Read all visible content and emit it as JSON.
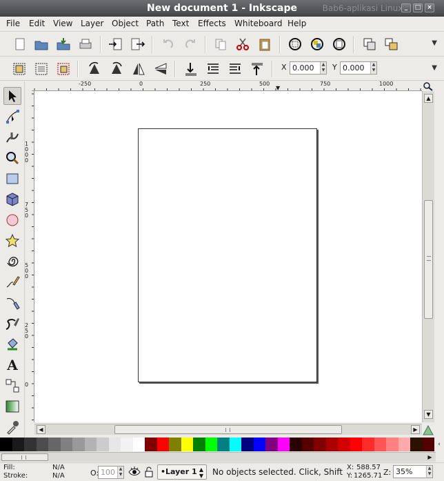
{
  "window": {
    "title": "New document 1 - Inkscape",
    "watermark": "Bab6-aplikasi Linux"
  },
  "menu": {
    "items": [
      "File",
      "Edit",
      "View",
      "Layer",
      "Object",
      "Path",
      "Text",
      "Effects",
      "Whiteboard",
      "Help"
    ]
  },
  "commands_bar": {
    "icons": [
      "new-document-icon",
      "open-icon",
      "save-icon",
      "print-icon",
      "import-icon",
      "export-icon",
      "undo-icon",
      "redo-icon",
      "copy-icon",
      "cut-icon",
      "paste-icon",
      "zoom-selection-icon",
      "zoom-drawing-icon",
      "zoom-page-icon",
      "duplicate-icon",
      "clone-icon"
    ]
  },
  "controls_bar": {
    "icons": [
      "select-all-icon",
      "select-in-all-layers-icon",
      "deselect-icon",
      "rotate-ccw-icon",
      "rotate-cw-icon",
      "flip-horizontal-icon",
      "flip-vertical-icon",
      "lower-to-bottom-icon",
      "lower-icon",
      "raise-icon",
      "raise-to-top-icon"
    ],
    "x_label": "X",
    "x_value": "0.000",
    "y_label": "Y",
    "y_value": "0.000"
  },
  "tools": [
    "selector-tool",
    "node-tool",
    "tweak-tool",
    "zoom-tool",
    "rectangle-tool",
    "3d-box-tool",
    "ellipse-tool",
    "star-tool",
    "spiral-tool",
    "pencil-tool",
    "pen-tool",
    "calligraphy-tool",
    "paint-bucket-tool",
    "text-tool",
    "connector-tool",
    "gradient-tool",
    "dropper-tool"
  ],
  "ruler": {
    "horizontal": [
      "-250",
      "0",
      "250",
      "500",
      "750",
      "1000"
    ],
    "vertical": [
      "1000",
      "750",
      "500",
      "250",
      "0"
    ]
  },
  "palette": {
    "colors": [
      "#000000",
      "#1a1a1a",
      "#333333",
      "#4d4d4d",
      "#666666",
      "#808080",
      "#999999",
      "#b3b3b3",
      "#cccccc",
      "#e6e6e6",
      "#f2f2f2",
      "#ffffff",
      "#800000",
      "#ff0000",
      "#808000",
      "#ffff00",
      "#008000",
      "#00ff00",
      "#008080",
      "#00ffff",
      "#000080",
      "#0000ff",
      "#800080",
      "#ff00ff",
      "#2b0000",
      "#550000",
      "#800000",
      "#aa0000",
      "#d40000",
      "#ff0000",
      "#ff2a2a",
      "#ff5555",
      "#ff8080",
      "#ffaaaa",
      "#2b1100",
      "#550000"
    ]
  },
  "status": {
    "fill_label": "Fill:",
    "fill_value": "N/A",
    "stroke_label": "Stroke:",
    "stroke_value": "N/A",
    "opacity_label": "O:",
    "opacity_value": "100",
    "layer": "•Layer 1",
    "message": "No objects selected. Click, Shift+",
    "x_label": "X:",
    "x_coord": "588.57",
    "y_label": "Y:",
    "y_coord": "1265.71",
    "zoom_label": "Z:",
    "zoom_value": "35%"
  }
}
